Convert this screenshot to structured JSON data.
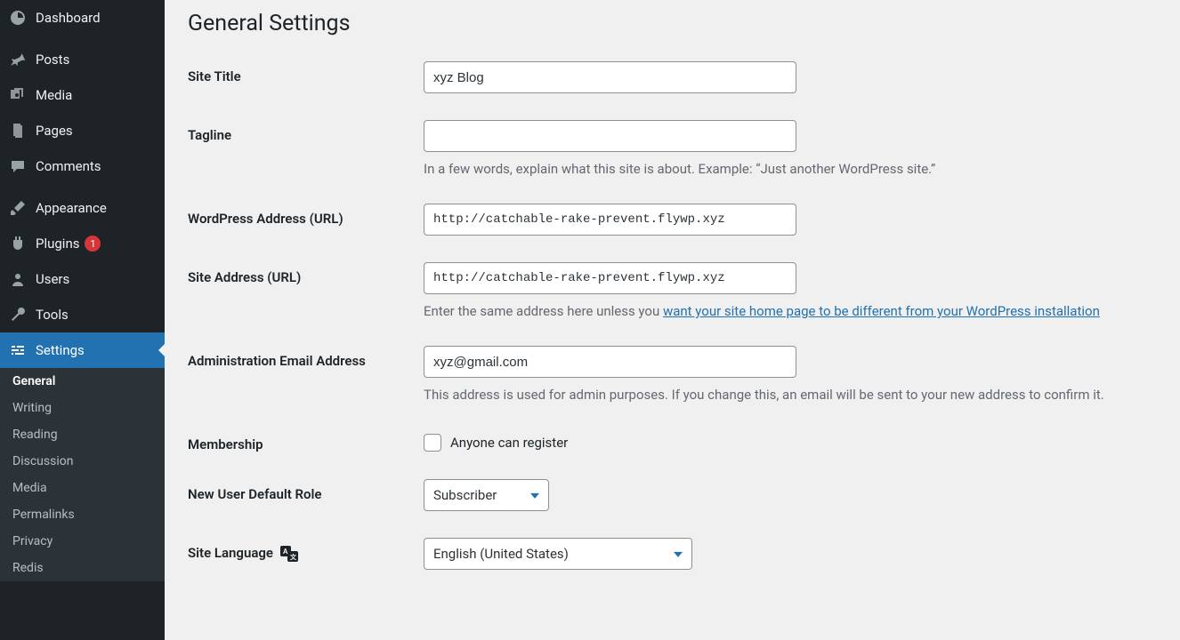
{
  "sidebar": {
    "items": [
      {
        "label": "Dashboard"
      },
      {
        "label": "Posts"
      },
      {
        "label": "Media"
      },
      {
        "label": "Pages"
      },
      {
        "label": "Comments"
      },
      {
        "label": "Appearance"
      },
      {
        "label": "Plugins",
        "badge": "1"
      },
      {
        "label": "Users"
      },
      {
        "label": "Tools"
      },
      {
        "label": "Settings"
      }
    ],
    "submenu": [
      {
        "label": "General"
      },
      {
        "label": "Writing"
      },
      {
        "label": "Reading"
      },
      {
        "label": "Discussion"
      },
      {
        "label": "Media"
      },
      {
        "label": "Permalinks"
      },
      {
        "label": "Privacy"
      },
      {
        "label": "Redis"
      }
    ]
  },
  "page": {
    "title": "General Settings"
  },
  "form": {
    "site_title": {
      "label": "Site Title",
      "value": "xyz Blog"
    },
    "tagline": {
      "label": "Tagline",
      "value": "",
      "help": "In a few words, explain what this site is about. Example: “Just another WordPress site.”"
    },
    "wp_url": {
      "label": "WordPress Address (URL)",
      "value": "http://catchable-rake-prevent.flywp.xyz"
    },
    "site_url": {
      "label": "Site Address (URL)",
      "value": "http://catchable-rake-prevent.flywp.xyz",
      "help_pre": "Enter the same address here unless you ",
      "help_link": "want your site home page to be different from your WordPress installation"
    },
    "admin_email": {
      "label": "Administration Email Address",
      "value": "xyz@gmail.com",
      "help": "This address is used for admin purposes. If you change this, an email will be sent to your new address to confirm it."
    },
    "membership": {
      "label": "Membership",
      "checkbox_label": "Anyone can register"
    },
    "default_role": {
      "label": "New User Default Role",
      "value": "Subscriber"
    },
    "language": {
      "label": "Site Language",
      "value": "English (United States)"
    }
  }
}
